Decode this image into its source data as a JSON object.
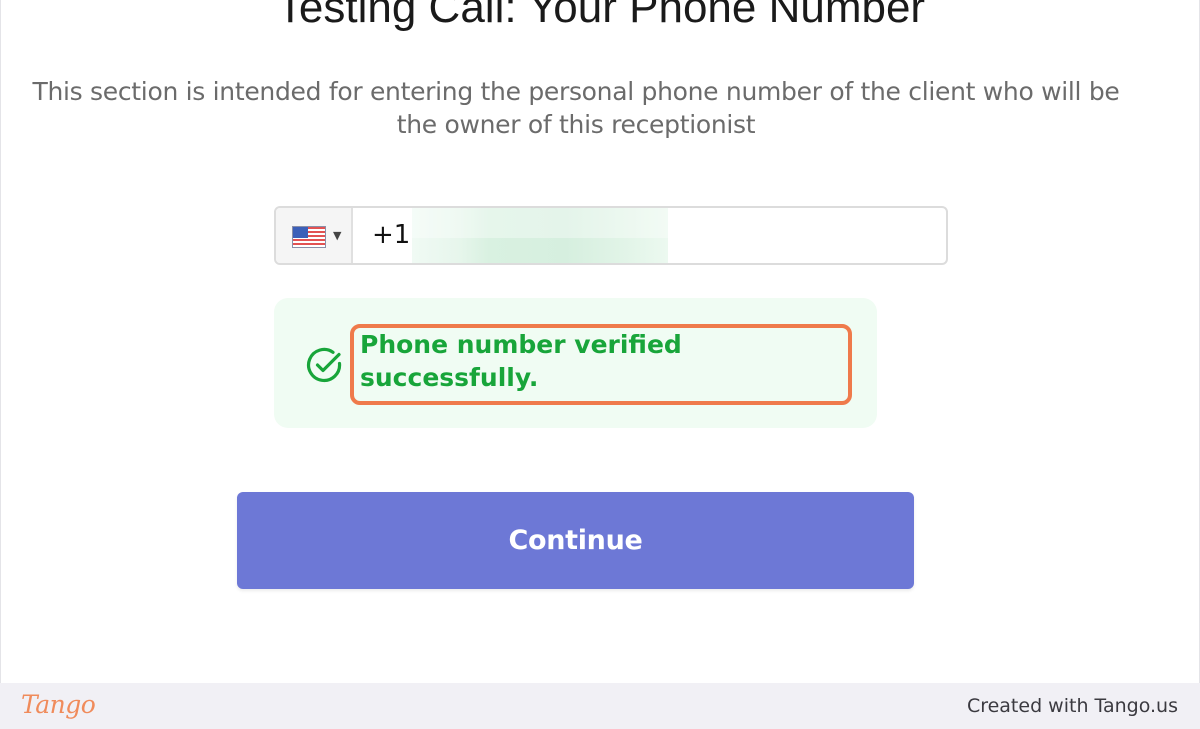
{
  "page": {
    "title": "Testing Call: Your Phone Number",
    "description": "This section is intended for entering the personal phone number of the client who will be the owner of this receptionist"
  },
  "phone": {
    "country_icon": "us-flag-icon",
    "dial_code": "+1",
    "number_value": "",
    "number_redacted": true
  },
  "verification": {
    "icon": "check-circle-icon",
    "message": "Phone number verified successfully.",
    "color": "#18a53a",
    "background": "#f0fcf3"
  },
  "actions": {
    "continue_label": "Continue",
    "continue_color": "#6d78d6"
  },
  "annotation": {
    "highlight_color": "#ef7a4b"
  },
  "footer": {
    "logo_text": "Tango",
    "credit": "Created with Tango.us"
  }
}
